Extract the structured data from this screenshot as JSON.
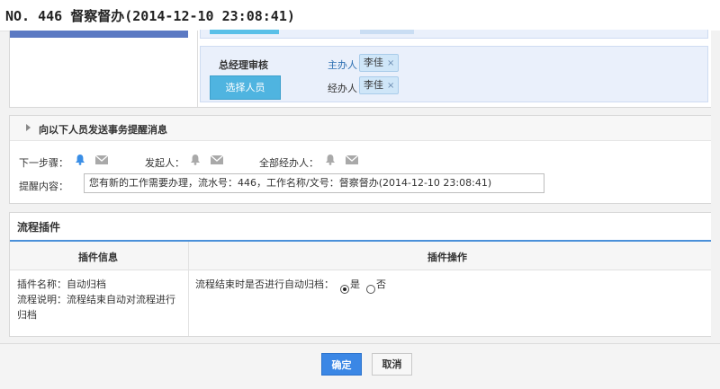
{
  "window": {
    "title": "NO. 446 督察督办(2014-12-10 23:08:41)"
  },
  "approval": {
    "stage_title": "总经理审核",
    "select_button": "选择人员",
    "main_label": "主办人：",
    "main_person": "李佳",
    "handle_label": "经办人：",
    "handle_person": "李佳",
    "remove_glyph": "×"
  },
  "reminder": {
    "header": "向以下人员发送事务提醒消息",
    "next_step_label": "下一步骤：",
    "initiator_label": "发起人：",
    "all_handlers_label": "全部经办人：",
    "content_label": "提醒内容：",
    "content_value": "您有新的工作需要办理，流水号：446，工作名称/文号：督察督办(2014-12-10 23:08:41)",
    "active_color": "#3a8ee6",
    "inactive_color": "#a9a9a9"
  },
  "plugin": {
    "title": "流程插件",
    "col_info": "插件信息",
    "col_action": "插件操作",
    "name_line": "插件名称：自动归档",
    "desc_line1": "流程说明：流程结束自动对流程进行",
    "desc_line2": "归档",
    "question": "流程结束时是否进行自动归档：",
    "opt_yes": "是",
    "opt_no": "否",
    "selected": "是"
  },
  "footer": {
    "ok_label": "确定",
    "cancel_label": "取消"
  }
}
